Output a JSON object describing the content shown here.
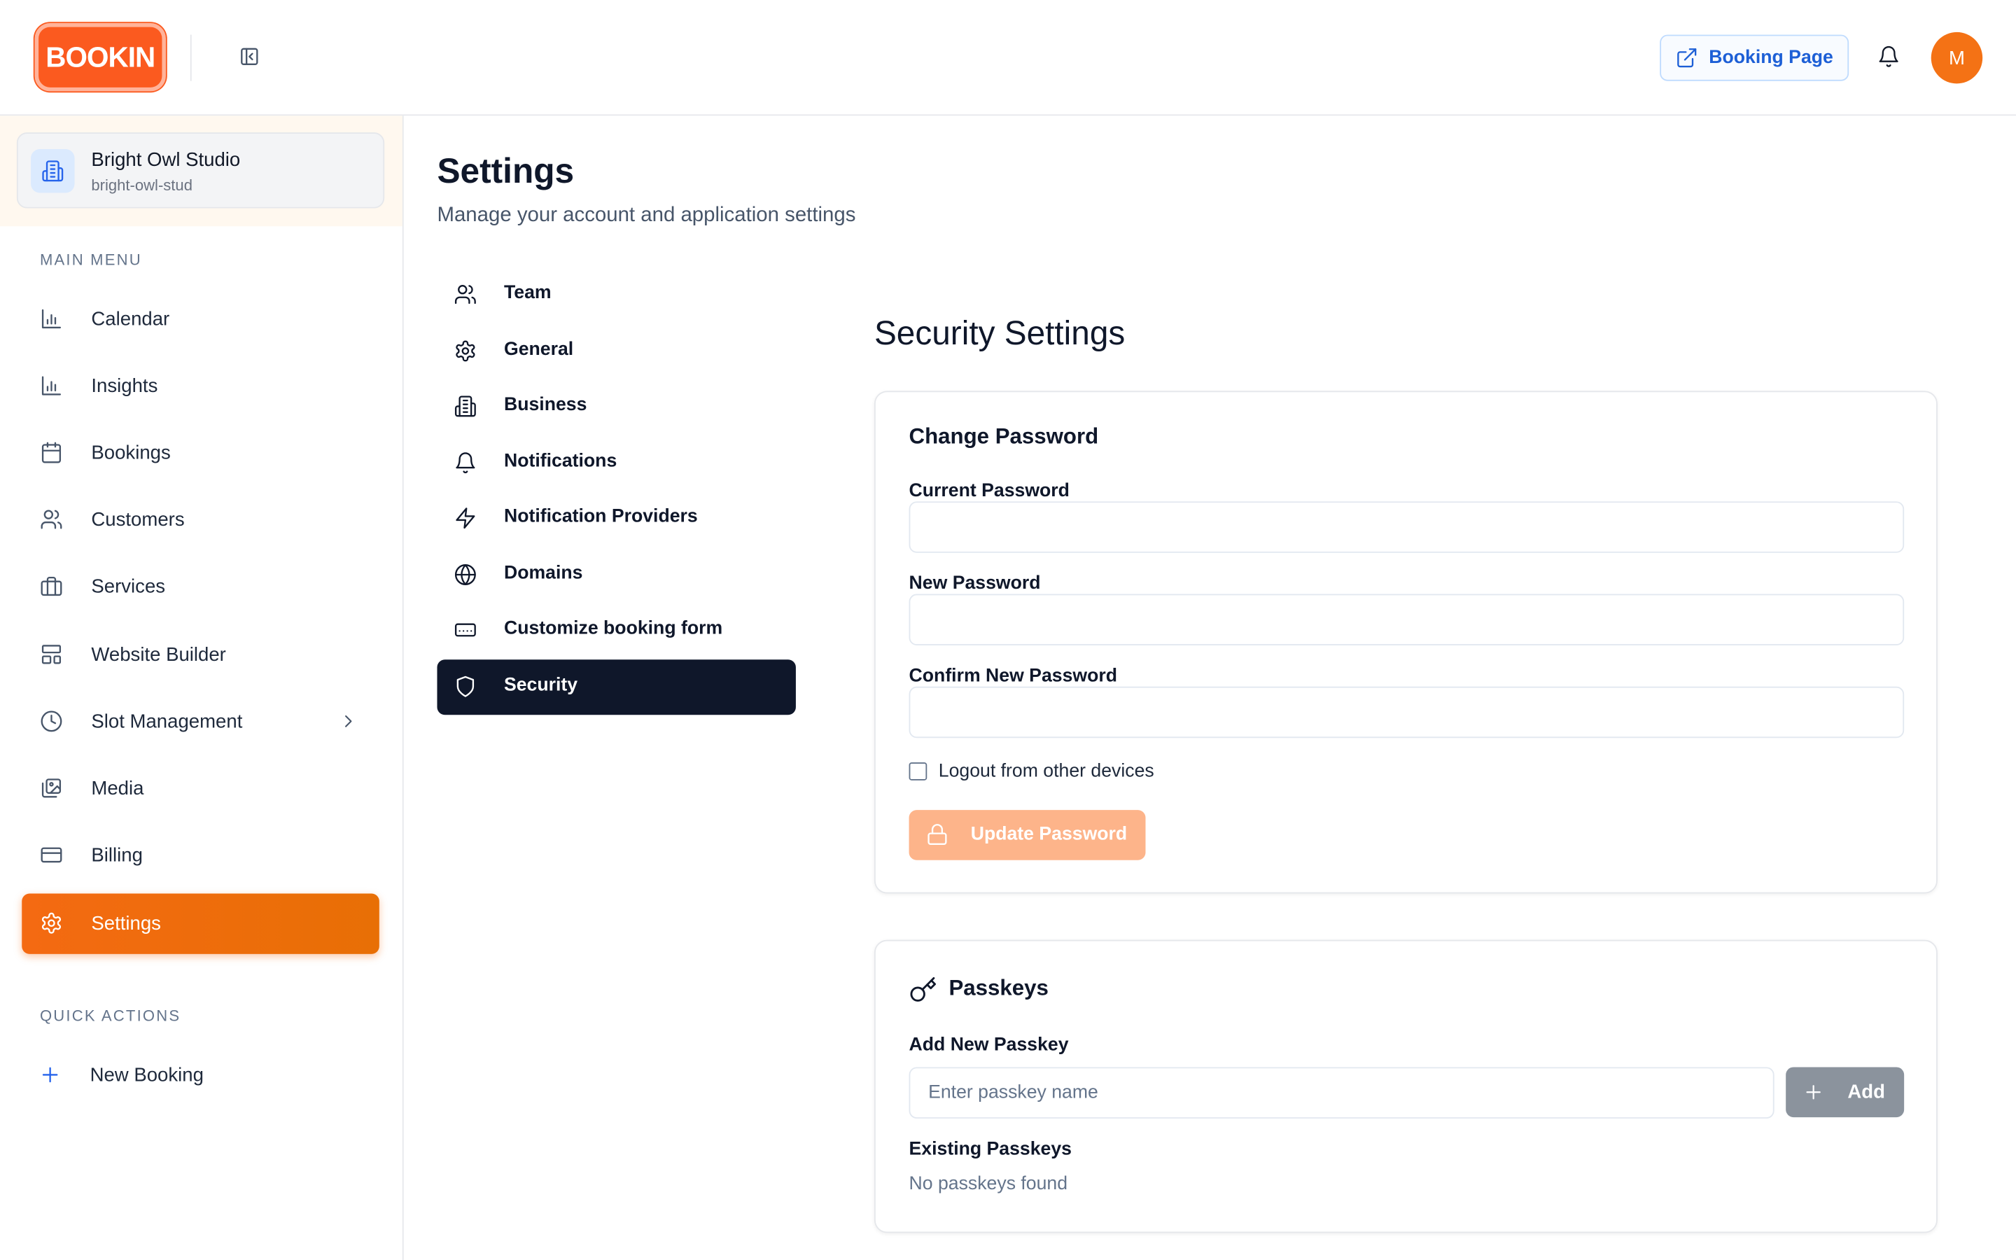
{
  "header": {
    "logo_text": "BOOKIN",
    "booking_page_label": "Booking Page",
    "avatar_initial": "M",
    "brand_color": "#fb5a1f"
  },
  "sidebar": {
    "org": {
      "name": "Bright Owl Studio",
      "slug": "bright-owl-stud"
    },
    "main_menu_label": "MAIN MENU",
    "items": [
      {
        "label": "Calendar",
        "icon": "bar-chart-icon"
      },
      {
        "label": "Insights",
        "icon": "bar-chart-icon"
      },
      {
        "label": "Bookings",
        "icon": "calendar-icon"
      },
      {
        "label": "Customers",
        "icon": "users-icon"
      },
      {
        "label": "Services",
        "icon": "briefcase-icon"
      },
      {
        "label": "Website Builder",
        "icon": "layout-icon"
      },
      {
        "label": "Slot Management",
        "icon": "clock-icon"
      },
      {
        "label": "Media",
        "icon": "images-icon"
      },
      {
        "label": "Billing",
        "icon": "credit-card-icon"
      },
      {
        "label": "Settings",
        "icon": "gear-icon",
        "active": true
      }
    ],
    "quick_actions_label": "QUICK ACTIONS",
    "new_booking_label": "New Booking",
    "active_color": "#f46a12"
  },
  "main": {
    "title": "Settings",
    "subtitle": "Manage your account and application settings",
    "settings_nav": [
      {
        "label": "Team",
        "icon": "users-icon"
      },
      {
        "label": "General",
        "icon": "gear-icon"
      },
      {
        "label": "Business",
        "icon": "building-icon"
      },
      {
        "label": "Notifications",
        "icon": "bell-icon"
      },
      {
        "label": "Notification Providers",
        "icon": "zap-icon"
      },
      {
        "label": "Domains",
        "icon": "globe-icon"
      },
      {
        "label": "Customize booking form",
        "icon": "form-icon"
      },
      {
        "label": "Security",
        "icon": "shield-icon",
        "active": true
      }
    ],
    "security_title": "Security Settings",
    "change_password": {
      "title": "Change Password",
      "current_label": "Current Password",
      "current_value": "",
      "new_label": "New Password",
      "new_value": "",
      "confirm_label": "Confirm New Password",
      "confirm_value": "",
      "logout_label": "Logout from other devices",
      "update_label": "Update Password"
    },
    "passkeys": {
      "title": "Passkeys",
      "add_label": "Add New Passkey",
      "input_placeholder": "Enter passkey name",
      "add_button": "Add",
      "existing_label": "Existing Passkeys",
      "empty_text": "No passkeys found"
    }
  }
}
